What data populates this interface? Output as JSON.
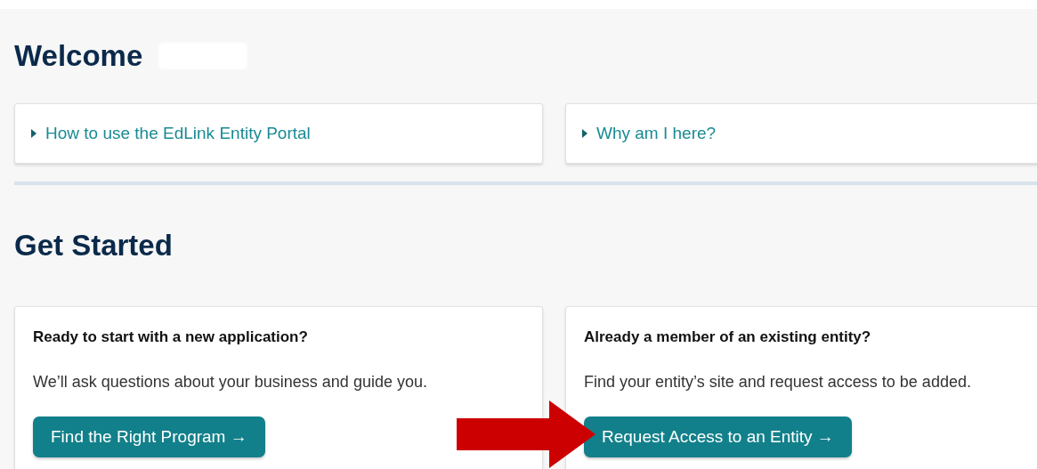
{
  "welcome": {
    "title": "Welcome"
  },
  "help_links": [
    {
      "label": "How to use the EdLink Entity Portal",
      "expanded": false
    },
    {
      "label": "Why am I here?",
      "expanded": false
    }
  ],
  "get_started": {
    "title": "Get Started",
    "cards": [
      {
        "title": "Ready to start with a new application?",
        "description": "We’ll ask questions about your business and guide you.",
        "button": "Find the Right Program →"
      },
      {
        "title": "Already a member of an existing entity?",
        "description": "Find your entity’s site and request access to be added.",
        "button": "Request Access to an Entity →"
      }
    ]
  }
}
